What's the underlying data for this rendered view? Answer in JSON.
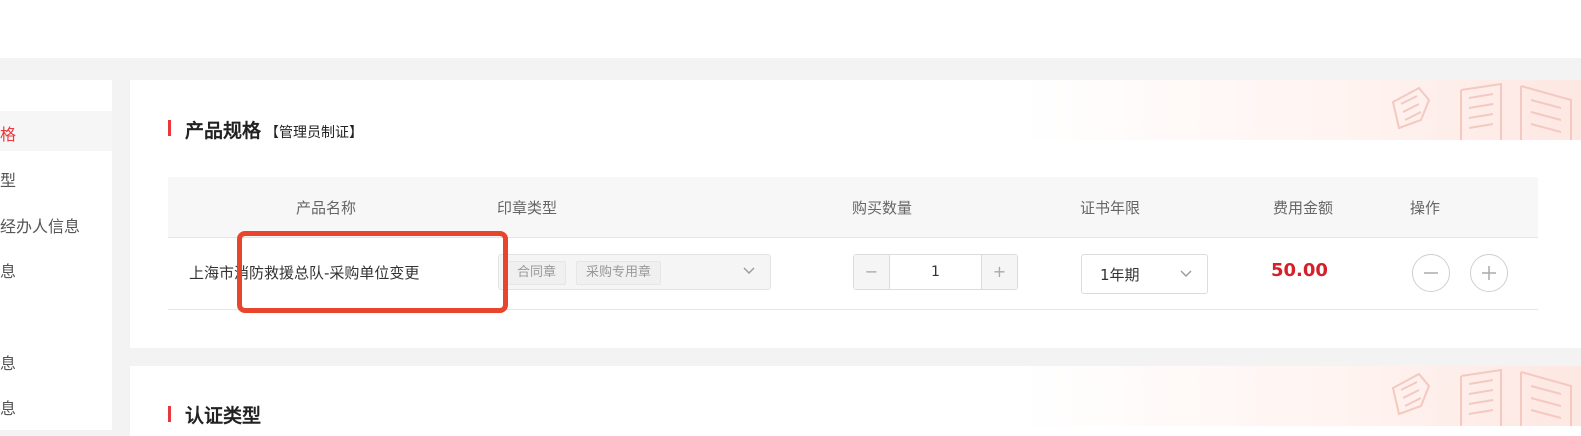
{
  "sidebar": {
    "items": [
      {
        "label": "格",
        "active": true
      },
      {
        "label": "型",
        "active": false
      },
      {
        "label": "经办人信息",
        "active": false
      },
      {
        "label": "息",
        "active": false
      },
      {
        "label": "息",
        "active": false
      },
      {
        "label": "息",
        "active": false
      }
    ]
  },
  "product_spec": {
    "title": "产品规格",
    "tag": "【管理员制证】",
    "columns": [
      "产品名称",
      "印章类型",
      "购买数量",
      "证书年限",
      "费用金额",
      "操作"
    ],
    "row": {
      "product_name": "上海市消防救援总队-采购单位变更",
      "seal_tags": [
        "合同章",
        "采购专用章"
      ],
      "quantity": "1",
      "minus_symbol": "−",
      "plus_symbol": "+",
      "term": "1年期",
      "fee": "50.00"
    }
  },
  "auth_type": {
    "title": "认证类型"
  },
  "colors": {
    "accent": "#e8383d",
    "fee": "#d4202a",
    "highlight": "#e8452c"
  }
}
